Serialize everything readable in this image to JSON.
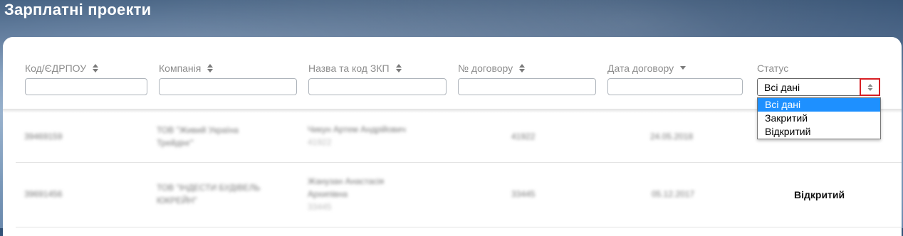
{
  "page": {
    "title": "Зарплатні проекти"
  },
  "filters": {
    "columns": [
      {
        "id": "code",
        "label": "Код/ЄДРПОУ",
        "sort": "both"
      },
      {
        "id": "company",
        "label": "Компанія",
        "sort": "both"
      },
      {
        "id": "zkp",
        "label": "Назва та код ЗКП",
        "sort": "both"
      },
      {
        "id": "contract_no",
        "label": "№ договору",
        "sort": "both"
      },
      {
        "id": "contract_date",
        "label": "Дата договору",
        "sort": "desc"
      },
      {
        "id": "status",
        "label": "Статус"
      }
    ],
    "status": {
      "selected": "Всі дані",
      "options": [
        "Всі дані",
        "Закритий",
        "Відкритий"
      ],
      "selected_index": 0
    }
  },
  "rows": [
    {
      "code": "39469159",
      "company": [
        "ТОВ \"Живий Україна",
        "Трейдінг\""
      ],
      "zkp": [
        "Чикун Артем Андрійович",
        "41922"
      ],
      "contract_no": "41922",
      "contract_date": "24.05.2018",
      "status": ""
    },
    {
      "code": "39691456",
      "company": [
        "ТОВ \"ІНДЕСТИ БУДІВЕЛЬ",
        "ЮКРЕЙН\""
      ],
      "zkp": [
        "Жанузан Анастасія",
        "Архипівна",
        "33445"
      ],
      "contract_no": "33445",
      "contract_date": "05.12.2017",
      "status": "Відкритий"
    }
  ],
  "colors": {
    "accent_select": "#1e90ff",
    "highlight_border": "#d71f24",
    "label": "#8d8d8d"
  },
  "icons": {
    "sort_both": "sort-updown-icon",
    "sort_desc": "sort-down-icon",
    "select_arrow": "select-updown-icon"
  }
}
